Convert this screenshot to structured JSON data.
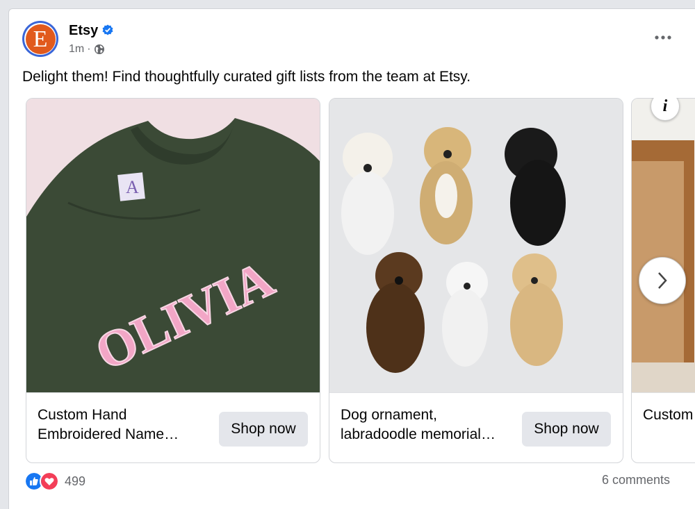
{
  "post": {
    "page_name": "Etsy",
    "avatar_letter": "E",
    "time": "1m",
    "separator": "·",
    "caption": "Delight them! Find thoughtfully curated gift lists from the team at Etsy.",
    "more_label": "•••"
  },
  "carousel": {
    "info_label": "i",
    "cards": [
      {
        "title": "Custom Hand Embroidered Name…",
        "button": "Shop now",
        "image_text": "OLIVIA",
        "tag_letter": "A"
      },
      {
        "title": "Dog ornament, labradoodle memorial…",
        "button": "Shop now"
      },
      {
        "title": "Custom Portrait"
      }
    ]
  },
  "footer": {
    "reaction_count": "499",
    "comments": "6 comments"
  },
  "colors": {
    "etsy_orange": "#e15a1d",
    "verified_blue": "#1877f2",
    "like_blue": "#1877f2",
    "love_red": "#f33e58",
    "sweater_green": "#3b4a36"
  },
  "icons": [
    "verified-badge-icon",
    "globe-icon",
    "more-options-icon",
    "info-icon",
    "chevron-right-icon",
    "like-reaction-icon",
    "love-reaction-icon"
  ]
}
